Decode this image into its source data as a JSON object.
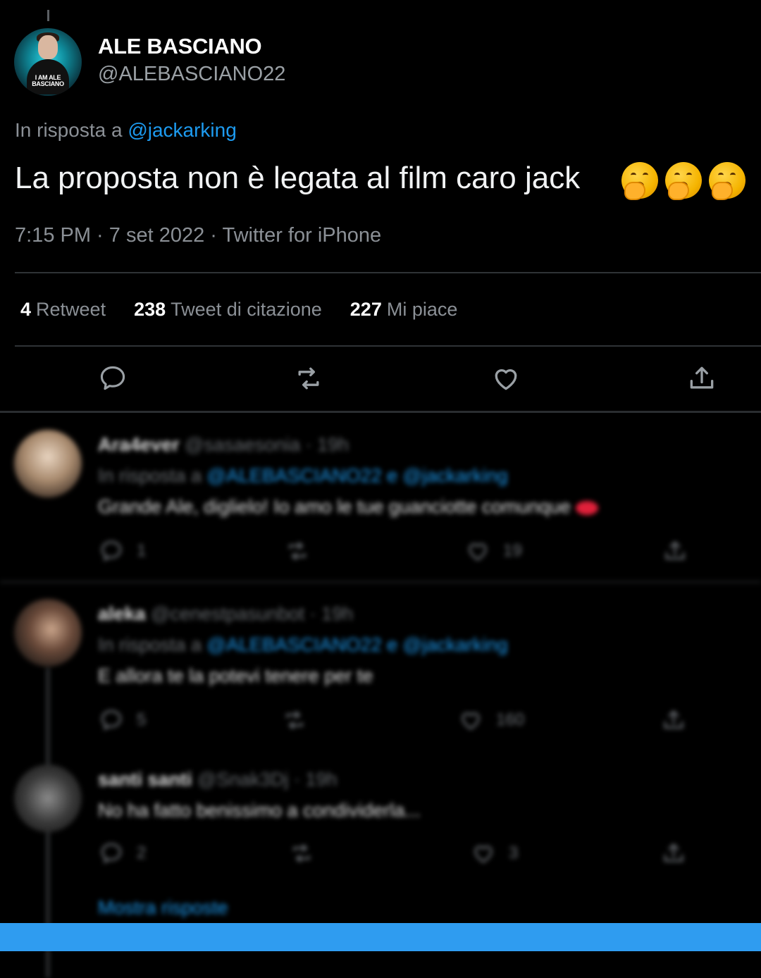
{
  "tweet": {
    "author_name": "ALE BASCIANO",
    "author_handle": "@ALEBASCIANO22",
    "avatar_tag": "I AM ALE BASCIANO",
    "reply_prefix": "In risposta a",
    "reply_mention": "@jackarking",
    "text": "La proposta non è legata al film caro jack",
    "emoji_icon": "yawning-face-emoji",
    "emoji_count": 3,
    "meta": "7:15 PM · 7 set 2022 · Twitter for iPhone"
  },
  "stats": [
    {
      "count": "4",
      "label": "Retweet"
    },
    {
      "count": "238",
      "label": "Tweet di citazione"
    },
    {
      "count": "227",
      "label": "Mi piace"
    }
  ],
  "actions": [
    "reply-icon",
    "retweet-icon",
    "like-icon",
    "share-icon"
  ],
  "replies": [
    {
      "name": "Ara4ever",
      "handle_time": "@sasaesonia · 19h",
      "reply_prefix": "In risposta a",
      "mentions": "@ALEBASCIANO22 e @jackarking",
      "text": "Grande Ale, diglielo! Io amo le tue guanciotte comunque",
      "reply_count": "1",
      "like_count": "19"
    },
    {
      "name": "aleka",
      "handle_time": "@cenestpasunbot · 19h",
      "reply_prefix": "In risposta a",
      "mentions": "@ALEBASCIANO22 e @jackarking",
      "text": "E allora te la potevi tenere per te",
      "reply_count": "5",
      "like_count": "160"
    },
    {
      "name": "santi santi",
      "handle_time": "@Snak3Dj · 19h",
      "text": "No ha fatto benissimo a condividerla...",
      "reply_count": "2",
      "like_count": "3"
    }
  ],
  "show_replies": "Mostra risposte",
  "colors": {
    "background": "#000000",
    "accent": "#1d9bf0",
    "muted": "#8b9096",
    "divider": "#2f3336",
    "bottom_bar": "#2f9cf0"
  }
}
